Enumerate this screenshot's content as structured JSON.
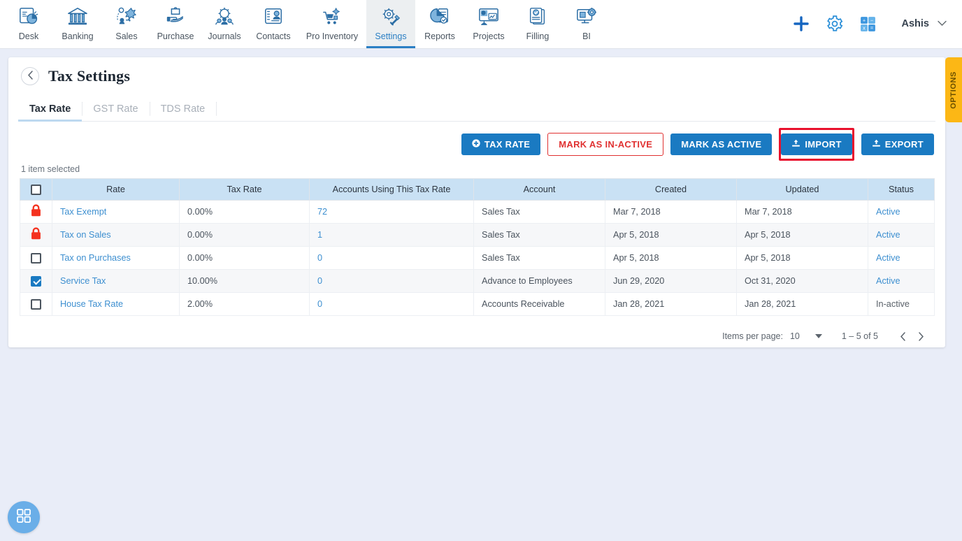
{
  "topnav": {
    "items": [
      {
        "label": "Desk",
        "icon": "desk-chart-icon",
        "active": false
      },
      {
        "label": "Banking",
        "icon": "bank-building-icon",
        "active": false
      },
      {
        "label": "Sales",
        "icon": "sales-network-icon",
        "active": false
      },
      {
        "label": "Purchase",
        "icon": "purchase-hand-bag-icon",
        "active": false
      },
      {
        "label": "Journals",
        "icon": "journals-gear-people-icon",
        "active": false
      },
      {
        "label": "Contacts",
        "icon": "contacts-card-icon",
        "active": false
      },
      {
        "label": "Pro Inventory",
        "icon": "inventory-cart-icon",
        "active": false
      },
      {
        "label": "Settings",
        "icon": "settings-gear-wrench-icon",
        "active": true
      },
      {
        "label": "Reports",
        "icon": "reports-pie-doc-icon",
        "active": false
      },
      {
        "label": "Projects",
        "icon": "projects-presentation-icon",
        "active": false
      },
      {
        "label": "Filling",
        "icon": "filling-documents-icon",
        "active": false
      },
      {
        "label": "BI",
        "icon": "bi-monitor-gear-icon",
        "active": false
      }
    ],
    "right": {
      "add_icon": "plus-icon",
      "settings_icon": "gear-icon",
      "calculator_icon": "calculator-icon",
      "user_name": "Ashis",
      "user_caret": "chevron-down-icon"
    }
  },
  "page": {
    "back_icon": "chevron-left-icon",
    "title": "Tax Settings"
  },
  "tabs": [
    {
      "label": "Tax Rate",
      "active": true
    },
    {
      "label": "GST Rate",
      "active": false
    },
    {
      "label": "TDS Rate",
      "active": false
    }
  ],
  "actions": {
    "tax_rate": {
      "label": "TAX RATE",
      "icon": "plus-circle-icon"
    },
    "mark_inactive": {
      "label": "MARK AS IN-ACTIVE"
    },
    "mark_active": {
      "label": "MARK AS ACTIVE"
    },
    "import": {
      "label": "IMPORT",
      "icon": "upload-icon",
      "highlighted": true
    },
    "export": {
      "label": "EXPORT",
      "icon": "download-icon"
    }
  },
  "selection_text": "1 item selected",
  "table": {
    "columns": [
      "Rate",
      "Tax Rate",
      "Accounts Using This Tax Rate",
      "Account",
      "Created",
      "Updated",
      "Status"
    ],
    "header_checkbox": "unchecked",
    "rows": [
      {
        "select_state": "locked",
        "rate": "Tax Exempt",
        "tax_rate": "0.00%",
        "accounts_using": "72",
        "account": "Sales Tax",
        "created": "Mar 7, 2018",
        "updated": "Mar 7, 2018",
        "status": "Active",
        "status_link": true
      },
      {
        "select_state": "locked",
        "rate": "Tax on Sales",
        "tax_rate": "0.00%",
        "accounts_using": "1",
        "account": "Sales Tax",
        "created": "Apr 5, 2018",
        "updated": "Apr 5, 2018",
        "status": "Active",
        "status_link": true
      },
      {
        "select_state": "unchecked",
        "rate": "Tax on Purchases",
        "tax_rate": "0.00%",
        "accounts_using": "0",
        "account": "Sales Tax",
        "created": "Apr 5, 2018",
        "updated": "Apr 5, 2018",
        "status": "Active",
        "status_link": true
      },
      {
        "select_state": "checked",
        "rate": "Service Tax",
        "tax_rate": "10.00%",
        "accounts_using": "0",
        "account": "Advance to Employees",
        "created": "Jun 29, 2020",
        "updated": "Oct 31, 2020",
        "status": "Active",
        "status_link": true
      },
      {
        "select_state": "unchecked",
        "rate": "House Tax Rate",
        "tax_rate": "2.00%",
        "accounts_using": "0",
        "account": "Accounts Receivable",
        "created": "Jan 28, 2021",
        "updated": "Jan 28, 2021",
        "status": "In-active",
        "status_link": false
      }
    ]
  },
  "paginator": {
    "items_per_page_label": "Items per page:",
    "items_per_page_value": "10",
    "range_label": "1 – 5 of 5",
    "prev_icon": "chevron-left-icon",
    "next_icon": "chevron-right-icon"
  },
  "options_tab": {
    "label": "OPTIONS"
  },
  "fab": {
    "icon": "apps-grid-icon"
  },
  "colors": {
    "accent_blue": "#1a7ac2",
    "danger_red": "#e03131",
    "highlight_red": "#e8112d",
    "header_blue": "#c9e1f4",
    "options_amber": "#fcb715",
    "page_bg": "#e9edf8",
    "lock_red": "#f4321f"
  }
}
